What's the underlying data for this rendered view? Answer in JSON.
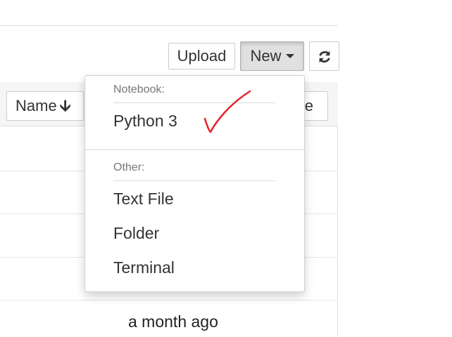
{
  "toolbar": {
    "upload_label": "Upload",
    "new_label": "New",
    "refresh_icon": "refresh-icon"
  },
  "list_header": {
    "name_label": "Name",
    "name_sort_glyph": "🡫",
    "size_label_partial": "ze"
  },
  "rows": [
    {
      "modified": "a month ago"
    }
  ],
  "new_menu": {
    "notebook_header": "Notebook:",
    "notebook_items": [
      "Python 3"
    ],
    "other_header": "Other:",
    "other_items": [
      "Text File",
      "Folder",
      "Terminal"
    ]
  },
  "annotation": {
    "checkmark_color": "#e8202a"
  }
}
